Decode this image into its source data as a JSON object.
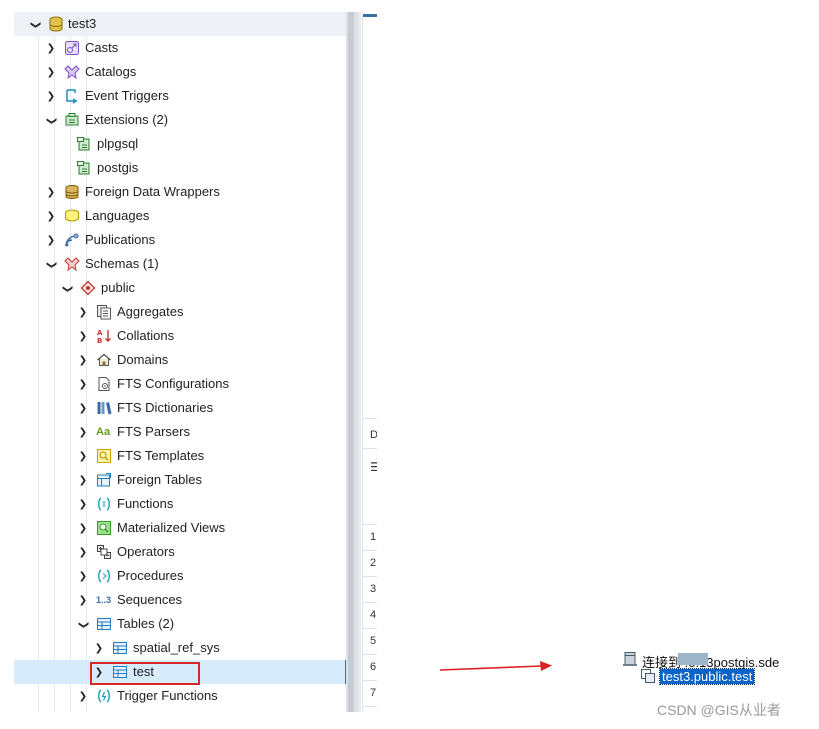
{
  "tree": {
    "root": {
      "label": "test3"
    },
    "items": [
      {
        "label": "Casts"
      },
      {
        "label": "Catalogs"
      },
      {
        "label": "Event Triggers"
      },
      {
        "label": "Extensions (2)"
      },
      {
        "label": "plpgsql"
      },
      {
        "label": "postgis"
      },
      {
        "label": "Foreign Data Wrappers"
      },
      {
        "label": "Languages"
      },
      {
        "label": "Publications"
      },
      {
        "label": "Schemas (1)"
      },
      {
        "label": "public"
      },
      {
        "label": "Aggregates"
      },
      {
        "label": "Collations"
      },
      {
        "label": "Domains"
      },
      {
        "label": "FTS Configurations"
      },
      {
        "label": "FTS Dictionaries"
      },
      {
        "label": "FTS Parsers"
      },
      {
        "label": "FTS Templates"
      },
      {
        "label": "Foreign Tables"
      },
      {
        "label": "Functions"
      },
      {
        "label": "Materialized Views"
      },
      {
        "label": "Operators"
      },
      {
        "label": "Procedures"
      },
      {
        "label": "Sequences"
      },
      {
        "label": "Tables (2)"
      },
      {
        "label": "spatial_ref_sys"
      },
      {
        "label": "test"
      },
      {
        "label": "Trigger Functions"
      }
    ],
    "selected_item": "test",
    "fts_parsers_glyph": "Aa",
    "sequences_glyph": "1..3"
  },
  "right_panel": {
    "tab_fragment": "D",
    "toolbar_fragment": "☰",
    "row_numbers": [
      "1",
      "2",
      "3",
      "4",
      "5",
      "6",
      "7"
    ]
  },
  "dialog_fragment": {
    "connection_label": "连接到       .0.13postgis.sde",
    "table_label": "test3.public.test"
  },
  "watermark": "CSDN @GIS从业者",
  "colors": {
    "selection": "#d6ecfb",
    "highlight_box": "#d9262b",
    "dialog_selection": "#0a64c8",
    "accent": "#3a6fa0"
  }
}
